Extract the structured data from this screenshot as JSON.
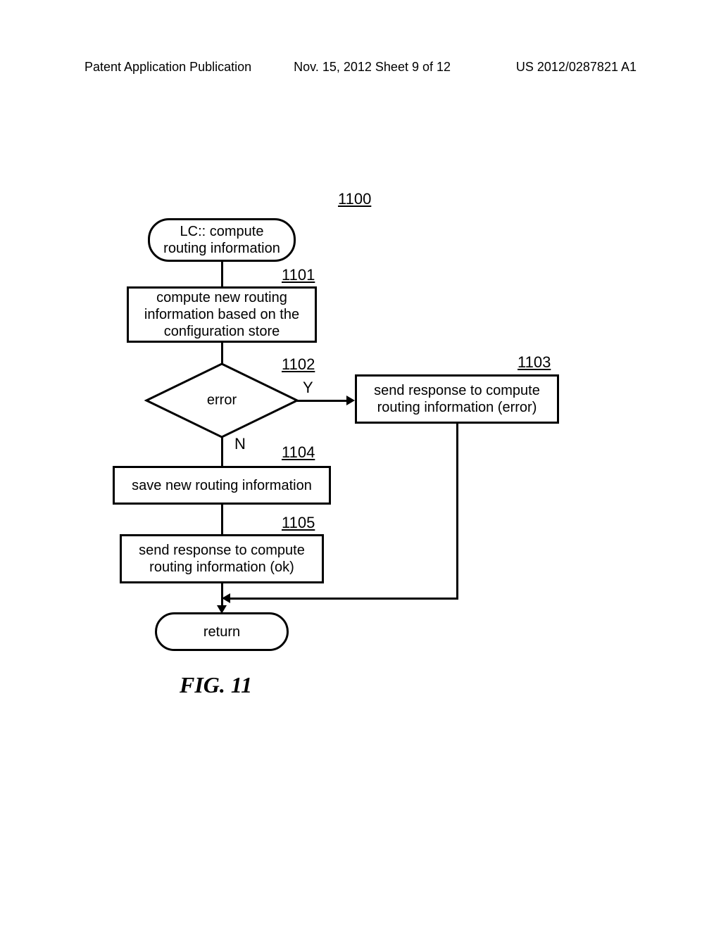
{
  "header": {
    "left": "Patent Application Publication",
    "mid": "Nov. 15, 2012  Sheet 9 of 12",
    "right": "US 2012/0287821 A1"
  },
  "figure_number": "1100",
  "flowchart": {
    "start": "LC:: compute\nrouting information",
    "step_1101": {
      "ref": "1101",
      "text": "compute new routing\ninformation based on the\nconfiguration store"
    },
    "step_1102": {
      "ref": "1102",
      "text": "error",
      "yes": "Y",
      "no": "N"
    },
    "step_1103": {
      "ref": "1103",
      "text": "send response to compute\nrouting information (error)"
    },
    "step_1104": {
      "ref": "1104",
      "text": "save new routing information"
    },
    "step_1105": {
      "ref": "1105",
      "text": "send response to compute\nrouting information (ok)"
    },
    "end": "return"
  },
  "caption": "FIG. 11"
}
